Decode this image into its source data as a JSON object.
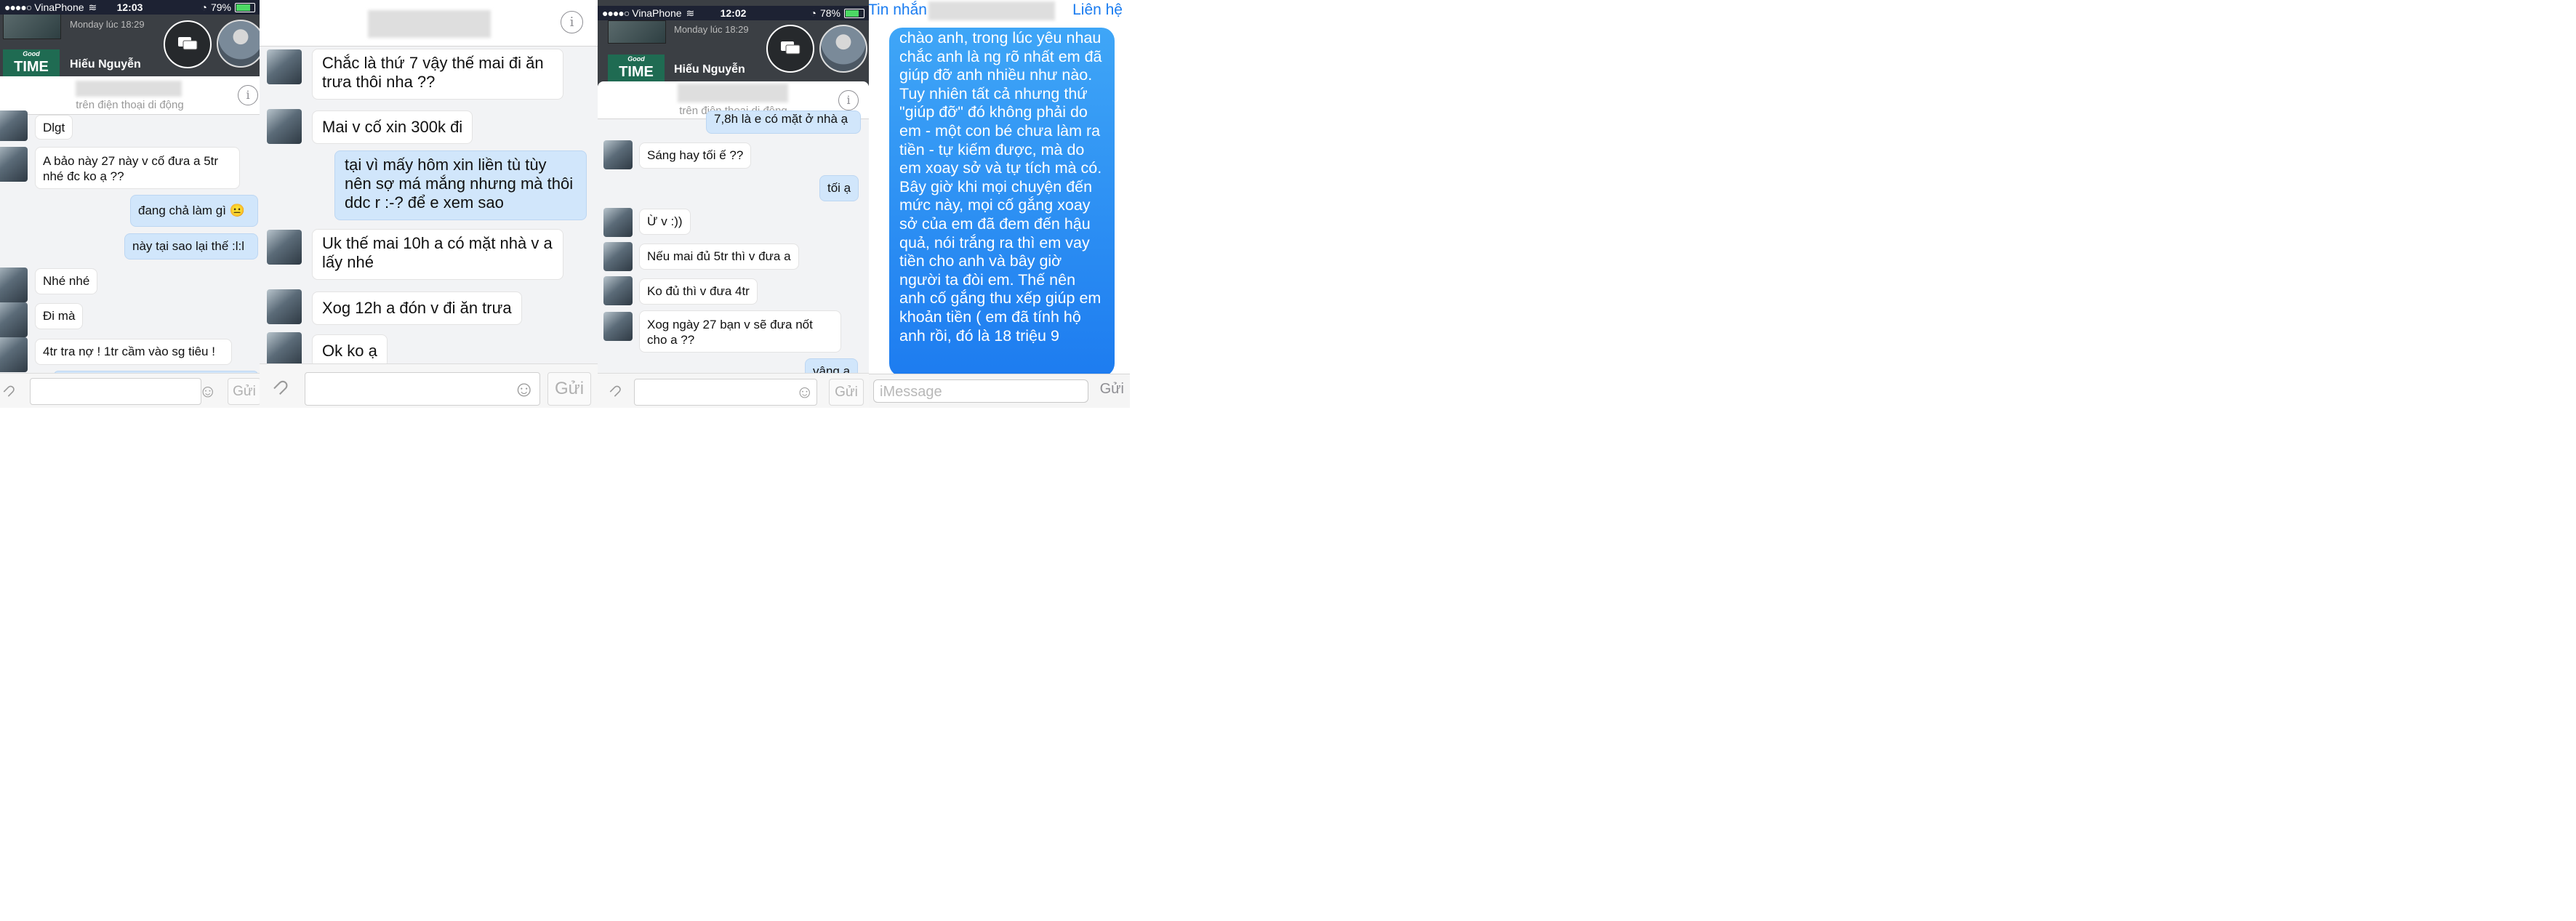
{
  "screens": [
    {
      "status": {
        "carrier": "VinaPhone",
        "time": "12:03",
        "battery": "79%",
        "battery_level": 0.79
      },
      "bg": {
        "date": "Monday lúc 18:29",
        "contact": "Hiếu Nguyễn",
        "logo_text": "TIME",
        "logo_top": "Good"
      },
      "header_subtitle": "trên điện thoại di động",
      "messages": [
        {
          "dir": "in",
          "text": "Dlgt"
        },
        {
          "dir": "in",
          "text": "A bảo này 27 này v cố đưa a 5tr nhé đc ko ạ ??"
        },
        {
          "dir": "out",
          "text": "đang chả làm gì 😐"
        },
        {
          "dir": "out",
          "text": "này tại sao lại thế :l:l"
        },
        {
          "dir": "in",
          "text": "Nhé nhé"
        },
        {
          "dir": "in",
          "text": "Đi mà"
        },
        {
          "dir": "in",
          "text": "4tr tra nợ ! 1tr cầm vào sg tiêu !"
        }
      ],
      "composer": {
        "send": "Gửi"
      }
    },
    {
      "messages": [
        {
          "dir": "in",
          "text": "Chắc là thứ 7 vậy thế mai đi ăn trưa thôi nha ??"
        },
        {
          "dir": "in",
          "text": "Mai v cố xin 300k đi"
        },
        {
          "dir": "out",
          "text": "tại vì mấy hôm xin liền tù tùy nên sợ má mắng nhưng mà thôi ddc r :-? để e xem sao"
        },
        {
          "dir": "in",
          "text": "Uk thế mai 10h a có mặt nhà v a lấy nhé"
        },
        {
          "dir": "in",
          "text": "Xog 12h a đón v đi ăn trưa"
        },
        {
          "dir": "in",
          "text": "Ok ko ạ"
        }
      ],
      "composer": {
        "send": "Gửi"
      }
    },
    {
      "status": {
        "carrier": "VinaPhone",
        "time": "12:02",
        "battery": "78%",
        "battery_level": 0.78
      },
      "bg": {
        "date": "Monday lúc 18:29",
        "contact": "Hiếu Nguyễn",
        "logo_text": "TIME",
        "logo_top": "Good"
      },
      "header_subtitle": "trên điện thoại di động",
      "messages": [
        {
          "dir": "out",
          "text": "7,8h là e có mặt ở nhà ạ"
        },
        {
          "dir": "in",
          "text": "Sáng hay tối ế ??"
        },
        {
          "dir": "out",
          "text": "tối ạ"
        },
        {
          "dir": "in",
          "text": "Ừ v :))"
        },
        {
          "dir": "in",
          "text": "Nếu mai đủ 5tr thì v đưa a"
        },
        {
          "dir": "in",
          "text": "Ko đủ thì v đưa 4tr"
        },
        {
          "dir": "in",
          "text": "Xog ngày 27 bạn v sẽ đưa nốt cho a ??"
        },
        {
          "dir": "out",
          "text": "vâng ạ"
        }
      ],
      "composer": {
        "send": "Gửi"
      }
    },
    {
      "nav": {
        "back": "Tin nhắn",
        "contact_btn": "Liên hệ"
      },
      "message": "chào anh, trong lúc yêu nhau chắc anh là ng rõ nhất em đã giúp đỡ anh nhiều như nào. Tuy nhiên tất cả nhưng thứ \"giúp đỡ\" đó không phải do em - một con bé chưa làm ra tiền - tự kiếm được, mà do em xoay sở và tự tích mà có. Bây giờ khi mọi chuyện đến mức này, mọi cố gắng xoay sở của em đã đem đến hậu quả, nói trắng ra thì em vay tiền cho anh và bây giờ người ta đòi em. Thế nên anh cố gắng thu xếp giúp em khoản tiền ( em đã tính hộ anh rồi, đó là 18 triệu 9",
      "composer": {
        "placeholder": "iMessage",
        "send": "Gửi"
      }
    }
  ]
}
